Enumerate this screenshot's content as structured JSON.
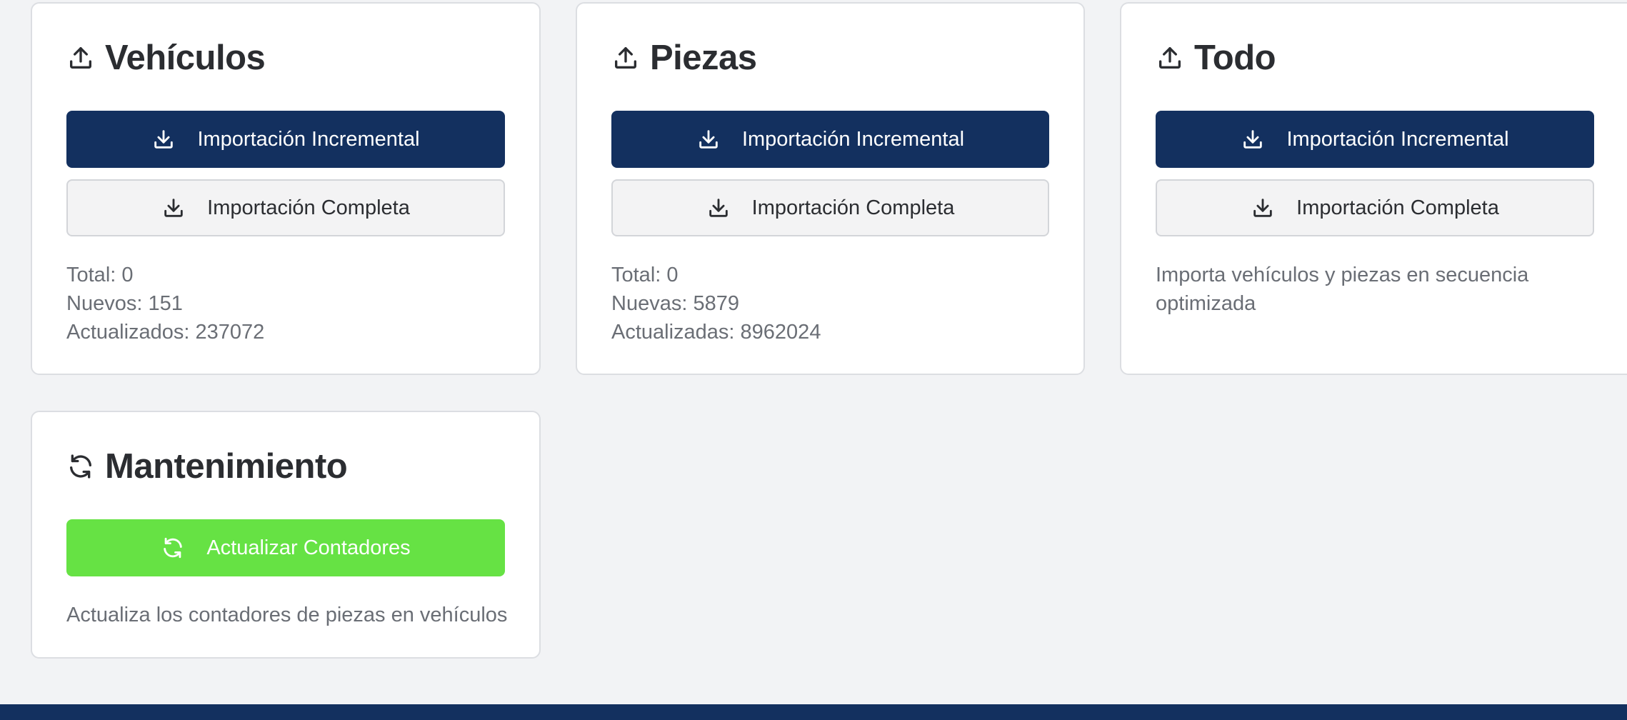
{
  "cards": {
    "vehiculos": {
      "title": "Vehículos",
      "incremental_label": "Importación Incremental",
      "complete_label": "Importación Completa",
      "stats": [
        "Total: 0",
        "Nuevos: 151",
        "Actualizados: 237072"
      ]
    },
    "piezas": {
      "title": "Piezas",
      "incremental_label": "Importación Incremental",
      "complete_label": "Importación Completa",
      "stats": [
        "Total: 0",
        "Nuevas: 5879",
        "Actualizadas: 8962024"
      ]
    },
    "todo": {
      "title": "Todo",
      "incremental_label": "Importación Incremental",
      "complete_label": "Importación Completa",
      "description": "Importa vehículos y piezas en secuencia optimizada"
    },
    "mantenimiento": {
      "title": "Mantenimiento",
      "action_label": "Actualizar Contadores",
      "description": "Actualiza los contadores de piezas en vehículos"
    }
  },
  "icons": {
    "card_header": "upload-icon",
    "maintenance_header": "refresh-icon",
    "import_button": "download-icon",
    "update_button": "refresh-icon"
  },
  "colors": {
    "primary": "#13305f",
    "success": "#66e244",
    "background": "#f2f3f5",
    "muted_text": "#6a6e75"
  }
}
